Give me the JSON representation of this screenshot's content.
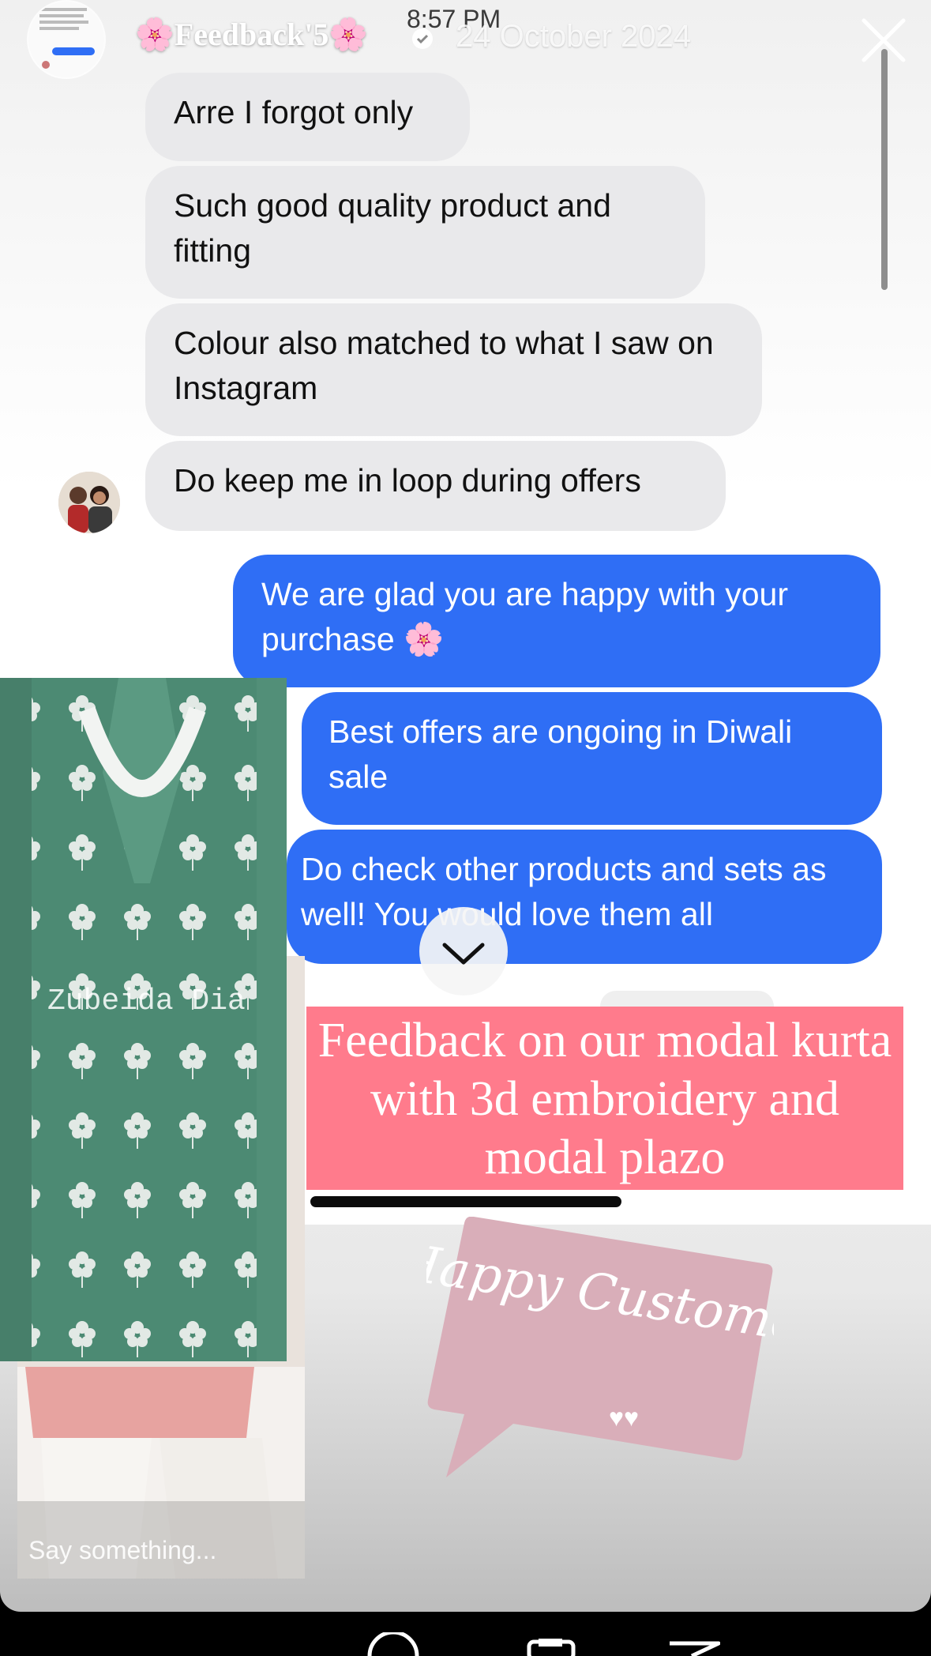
{
  "status": {
    "time": "8:57 PM"
  },
  "header": {
    "account_name": "🌸Feedback'5🌸",
    "date": "24 October 2024",
    "close_label": "close"
  },
  "chat": {
    "incoming": [
      "Arre I forgot only",
      "Such good quality product and fitting",
      "Colour also matched to what I saw on Instagram",
      "Do keep me in loop during offers"
    ],
    "outgoing": [
      "We are glad you are happy with your purchase 🌸",
      "Best offers are ongoing in Diwali sale",
      "Do check other products and sets as well! You would love them all"
    ]
  },
  "overlay": {
    "caption": "Feedback on our modal kurta with 3d embroidery and modal plazo",
    "sticker": "Happy Customer",
    "watermark": "Zubeida Dia"
  },
  "reply": {
    "placeholder": "Say something..."
  },
  "colors": {
    "outgoing_bubble": "#2f6ef5",
    "incoming_bubble": "#e9e9eb",
    "caption_bg": "#ff7b8c",
    "sticker_bg": "#d9aeb9",
    "kurta": "#4e8a74"
  },
  "icons": [
    "avatar",
    "verified-badge-icon",
    "close-icon",
    "chevron-down-icon",
    "reaction-icon",
    "share-icon",
    "send-icon"
  ]
}
